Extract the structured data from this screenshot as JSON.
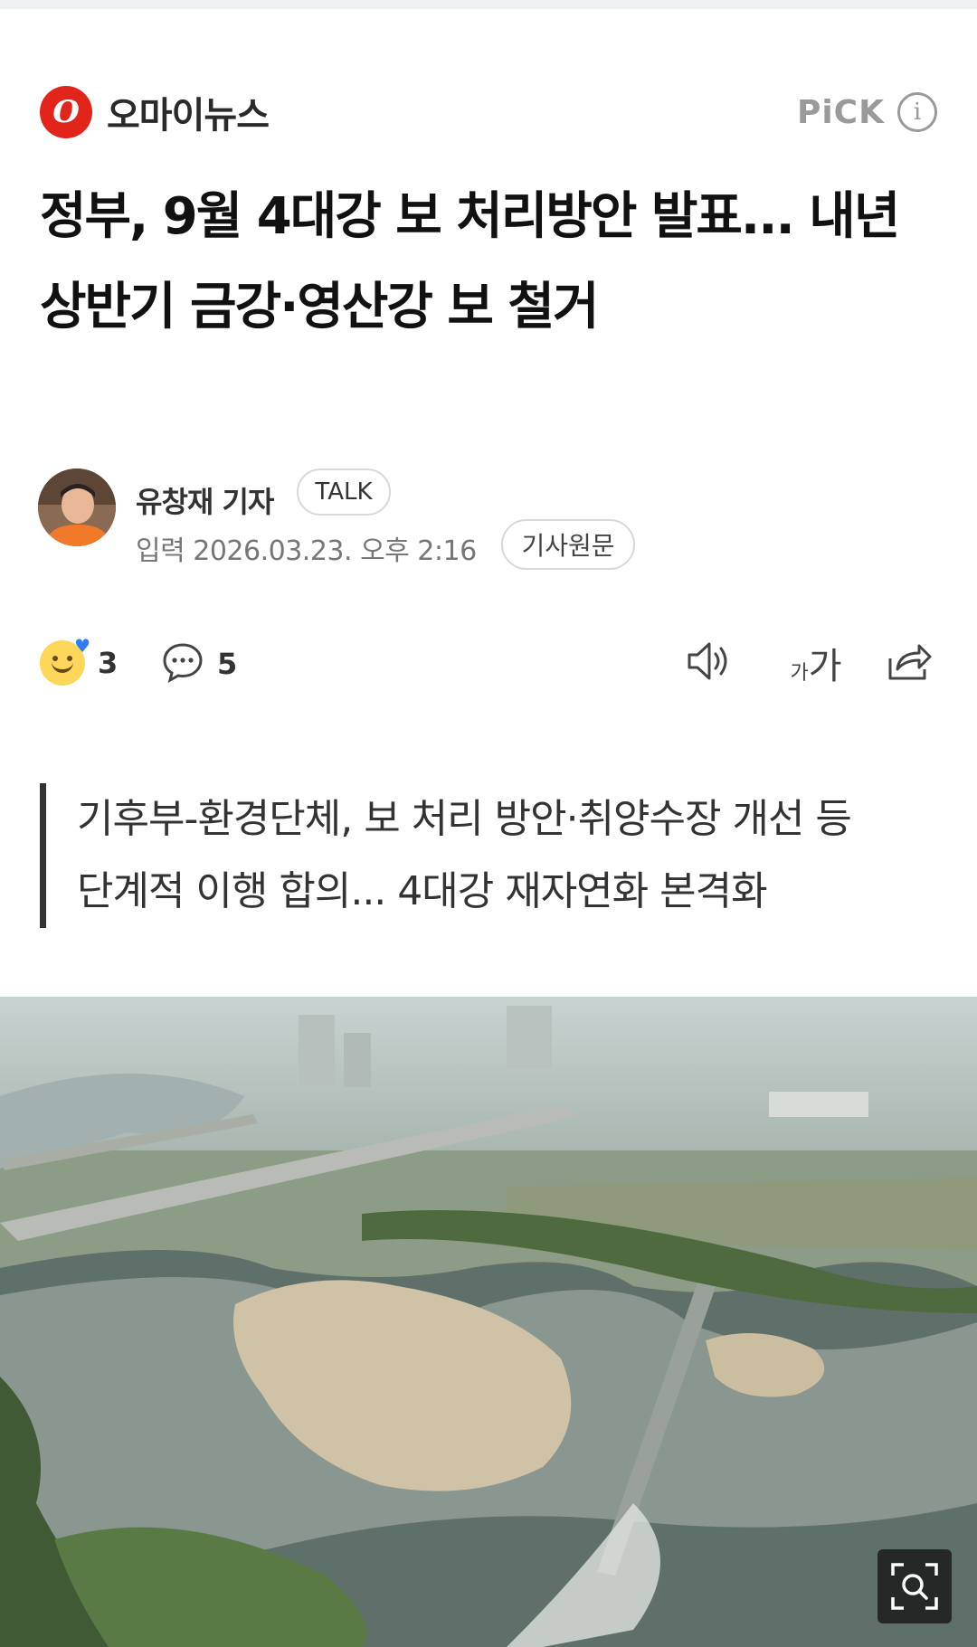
{
  "press": {
    "logo_letter": "O",
    "name": "오마이뉴스",
    "pick_label": "PiCK",
    "info_icon": "info-icon",
    "accent_color": "#e1251b"
  },
  "article": {
    "headline": "정부, 9월 4대강 보 처리방안 발표... 내년 상반기 금강·영산강 보 철거",
    "author": "유창재 기자",
    "talk_label": "TALK",
    "published": "입력 2026.03.23. 오후 2:16",
    "original_label": "기사원문",
    "summary_line1": "기후부-환경단체, 보 처리 방안·취양수장 개선 등",
    "summary_line2": "단계적 이행 합의... 4대강 재자연화 본격화"
  },
  "actions": {
    "reaction_count": "3",
    "comment_count": "5",
    "font_size_small": "가",
    "font_size_large": "가",
    "icons": [
      "smile-reaction-icon",
      "comment-icon",
      "speaker-icon",
      "font-size-icon",
      "share-icon"
    ]
  },
  "photo": {
    "zoom_icon": "zoom-icon"
  }
}
